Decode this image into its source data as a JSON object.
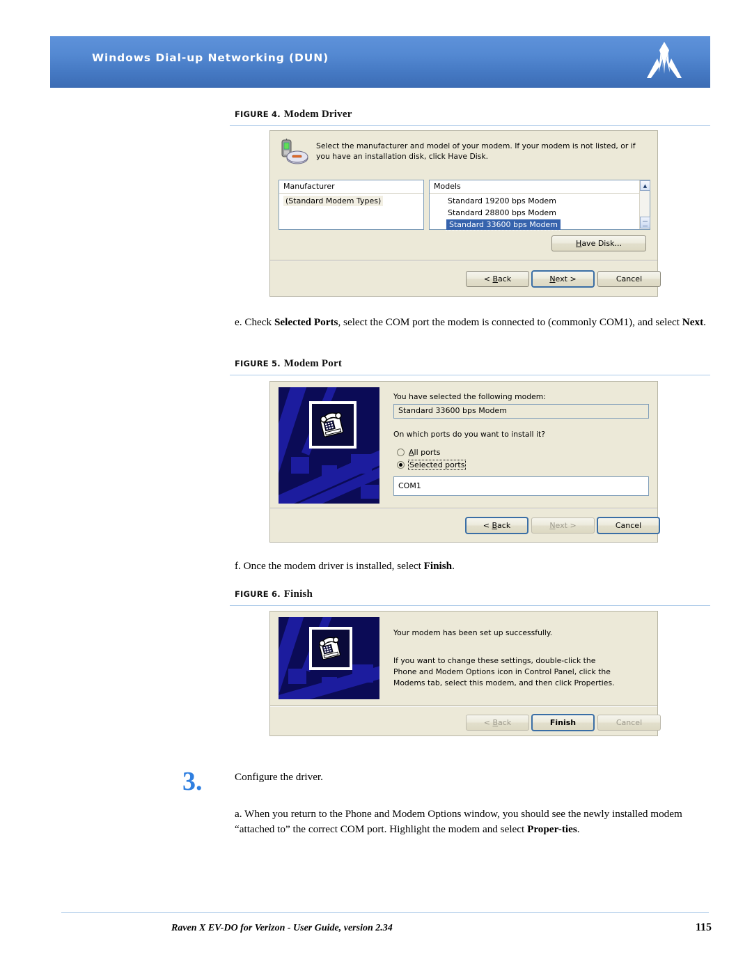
{
  "header": {
    "title": "Windows Dial-up Networking (DUN)",
    "logo_icon": "sierra-wireless-logo-icon",
    "gradient_top": "#5e92da",
    "gradient_bottom": "#3c6cb4"
  },
  "figures": [
    {
      "label": "FIGURE 4.",
      "name": "Modem Driver",
      "dialog": {
        "instruction": "Select the manufacturer and model of your modem. If your modem is not listed, or if you have an installation disk, click Have Disk.",
        "icon": "modem-device-icon",
        "manufacturer_header": "Manufacturer",
        "manufacturer_items": [
          "(Standard Modem Types)"
        ],
        "models_header": "Models",
        "models_items": [
          "Standard 19200 bps Modem",
          "Standard 28800 bps Modem",
          "Standard 33600 bps Modem"
        ],
        "selected_model": "Standard 33600 bps Modem",
        "have_disk_label": "Have Disk...",
        "buttons": {
          "back": "< Back",
          "next": "Next >",
          "cancel": "Cancel"
        }
      }
    },
    {
      "label": "FIGURE 5.",
      "name": "Modem Port",
      "dialog": {
        "selected_modem_label": "You have selected the following modem:",
        "selected_modem_value": "Standard 33600 bps Modem",
        "ports_question": "On which ports do you want to install it?",
        "radio_all_ports": "All ports",
        "radio_selected_ports": "Selected ports",
        "selected_radio": "Selected ports",
        "port_value": "COM1",
        "art_icon": "phone-modem-icon",
        "buttons": {
          "back": "< Back",
          "next": "Next >",
          "cancel": "Cancel"
        }
      }
    },
    {
      "label": "FIGURE 6.",
      "name": "Finish",
      "dialog": {
        "success_text": "Your modem has been set up successfully.",
        "detail_text": "If you want to change these settings, double-click the\nPhone and Modem Options icon in Control Panel, click the\nModems tab, select this modem, and then click Properties.",
        "art_icon": "phone-modem-icon",
        "buttons": {
          "back": "< Back",
          "finish": "Finish",
          "cancel": "Cancel"
        }
      }
    }
  ],
  "paragraphs": {
    "step_e": {
      "parts": [
        {
          "t": "e. Check ",
          "b": false
        },
        {
          "t": "Selected Ports",
          "b": true
        },
        {
          "t": ", select the COM port the modem is connected to (commonly COM1), and select ",
          "b": false
        },
        {
          "t": "Next",
          "b": true
        },
        {
          "t": ".",
          "b": false
        }
      ]
    },
    "step_f": {
      "parts": [
        {
          "t": "f. Once the modem driver is installed, select ",
          "b": false
        },
        {
          "t": "Finish",
          "b": true
        },
        {
          "t": ".",
          "b": false
        }
      ]
    },
    "step_3_number": "3.",
    "step_3_title": "Configure the driver.",
    "step_3a": {
      "parts": [
        {
          "t": "a. When you return to the Phone and Modem Options window, you should see the newly installed modem “attached to” the correct COM port.  Highlight the modem and select ",
          "b": false
        },
        {
          "t": "Proper-ties",
          "b": true
        },
        {
          "t": ".",
          "b": false
        }
      ]
    }
  },
  "footer": {
    "text": "Raven X EV-DO for Verizon - User Guide, version 2.34",
    "page": "115"
  }
}
